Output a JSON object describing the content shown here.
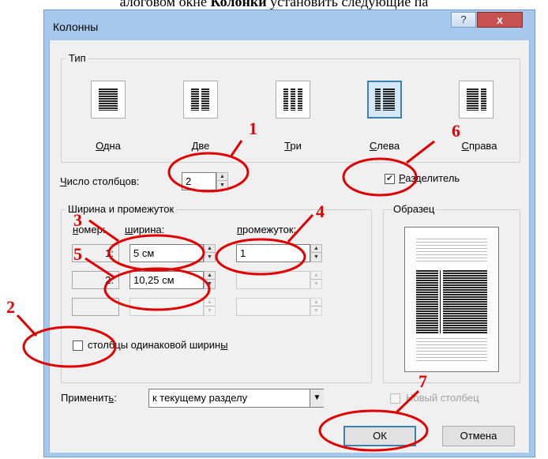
{
  "doc_text": {
    "prefix": "алоговом окне ",
    "bold": "Колонки",
    "suffix": " установить следующие па"
  },
  "dialog": {
    "title": "Колонны",
    "help_label": "?",
    "close_label": "x"
  },
  "type_group": {
    "label": "Тип",
    "options": [
      {
        "label": "Одна",
        "name": "one",
        "selected": false
      },
      {
        "label": "Две",
        "name": "two",
        "selected": false
      },
      {
        "label": "Три",
        "name": "three",
        "selected": false
      },
      {
        "label": "Слева",
        "name": "left",
        "selected": true
      },
      {
        "label": "Справа",
        "name": "right",
        "selected": false
      }
    ]
  },
  "num_columns": {
    "label": "Число столбцов:",
    "value": "2"
  },
  "separator": {
    "label": "Разделитель",
    "checked": true
  },
  "width_group": {
    "label": "Ширина и промежуток",
    "col_number": "номер:",
    "col_width": "ширина:",
    "col_gap": "промежуток:",
    "rows": [
      {
        "num": "1:",
        "width": "5 см",
        "gap": "1"
      },
      {
        "num": "2:",
        "width": "10,25 см",
        "gap": ""
      },
      {
        "num": "",
        "width": "",
        "gap": ""
      }
    ]
  },
  "equal_width": {
    "label": "столбцы одинаковой ширины",
    "checked": false
  },
  "preview": {
    "label": "Образец"
  },
  "apply": {
    "label": "Применить:",
    "value": "к текущему разделу"
  },
  "new_column": {
    "label": "Новый столбец",
    "checked": false
  },
  "ok_label": "ОК",
  "cancel_label": "Отмена",
  "annotations": [
    "1",
    "2",
    "3",
    "4",
    "5",
    "6",
    "7"
  ],
  "colors": {
    "annotation": "#e00000",
    "selected_border": "#3c7fb1",
    "titlebar": "#a6c8ec",
    "close": "#c75050"
  }
}
